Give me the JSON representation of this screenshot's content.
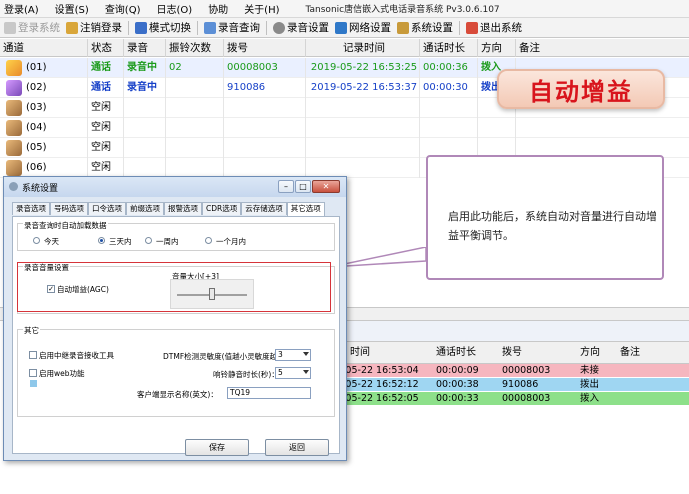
{
  "menu": {
    "items": [
      "登录(A)",
      "设置(S)",
      "查询(Q)",
      "日志(O)",
      "协助",
      "关于(H)"
    ],
    "title": "Tansonic唐信嵌入式电话录音系统 Pv3.0.6.107"
  },
  "toolbar": {
    "items": [
      {
        "label": "登录系统",
        "icon": "key-icon",
        "disabled": true
      },
      {
        "label": "注销登录",
        "icon": "lock-icon",
        "disabled": false
      },
      {
        "label": "模式切换",
        "icon": "monitor-icon",
        "disabled": false
      },
      {
        "label": "录音查询",
        "icon": "search-doc-icon",
        "disabled": false
      },
      {
        "label": "录音设置",
        "icon": "gear-icon",
        "disabled": false
      },
      {
        "label": "网络设置",
        "icon": "network-icon",
        "disabled": false
      },
      {
        "label": "系统设置",
        "icon": "settings-icon",
        "disabled": false
      },
      {
        "label": "退出系统",
        "icon": "exit-icon",
        "disabled": false
      }
    ]
  },
  "top_table": {
    "columns": [
      "通道",
      "状态",
      "录音",
      "振铃次数",
      "拨号",
      "记录时间",
      "通话时长",
      "方向",
      "备注"
    ],
    "rows": [
      {
        "channel": "(01)",
        "status": "通话",
        "record": "录音中",
        "rings": "02",
        "number": "00008003",
        "time": "2019-05-22 16:53:25",
        "duration": "00:00:36",
        "direction": "拨入",
        "color": "green"
      },
      {
        "channel": "(02)",
        "status": "通话",
        "record": "录音中",
        "rings": "",
        "number": "910086",
        "time": "2019-05-22 16:53:37",
        "duration": "00:00:30",
        "direction": "拨出",
        "color": "blue"
      },
      {
        "channel": "(03)",
        "status": "空闲",
        "record": "",
        "rings": "",
        "number": "",
        "time": "",
        "duration": "",
        "direction": "",
        "color": "none"
      },
      {
        "channel": "(04)",
        "status": "空闲",
        "record": "",
        "rings": "",
        "number": "",
        "time": "",
        "duration": "",
        "direction": "",
        "color": "none"
      },
      {
        "channel": "(05)",
        "status": "空闲",
        "record": "",
        "rings": "",
        "number": "",
        "time": "",
        "duration": "",
        "direction": "",
        "color": "none"
      },
      {
        "channel": "(06)",
        "status": "空闲",
        "record": "",
        "rings": "",
        "number": "",
        "time": "",
        "duration": "",
        "direction": "",
        "color": "none"
      }
    ]
  },
  "bottom_table": {
    "columns": [
      "时间",
      "通话时长",
      "拨号",
      "方向",
      "备注"
    ],
    "rows": [
      {
        "time": "-05-22 16:53:04",
        "duration": "00:00:09",
        "number": "00008003",
        "direction": "未接",
        "bg": "#f6b6bf"
      },
      {
        "time": "-05-22 16:52:12",
        "duration": "00:00:38",
        "number": "910086",
        "direction": "拨出",
        "bg": "#9fd6f2"
      },
      {
        "time": "-05-22 16:52:05",
        "duration": "00:00:33",
        "number": "00008003",
        "direction": "拨入",
        "bg": "#8de08a"
      }
    ]
  },
  "badge": {
    "text": "自动增益",
    "color": "#d8141c"
  },
  "callout": {
    "text": "启用此功能后，系统自动对音量进行自动增益平衡调节。"
  },
  "dialog": {
    "title": "系统设置",
    "tabs": [
      "录音选项",
      "号码选项",
      "口令选项",
      "前缀选项",
      "报警选项",
      "CDR选项",
      "云存储选项",
      "其它选项"
    ],
    "active_tab": "其它选项",
    "query_group": {
      "label": "录音查询时自动加载数据",
      "options": [
        "今天",
        "三天内",
        "一周内",
        "一个月内"
      ],
      "selected": "三天内"
    },
    "volume_group": {
      "label": "录音音量设置",
      "agc_label": "自动增益(AGC)",
      "agc_checked": true,
      "volume_label": "音量大小[+3]",
      "volume_level": 0.5
    },
    "other_group": {
      "label": "其它",
      "relay_label": "启用中继录音接收工具",
      "web_label": "启用web功能",
      "dtmf_label": "DTMF检测灵敏度(值越小灵敏度越高)：",
      "dtmf_value": "3",
      "mute_label": "响铃静音时长(秒)：",
      "mute_value": "5",
      "client_label": "客户端显示名称(英文)：",
      "client_value": "TQ19"
    },
    "save_label": "保存",
    "back_label": "返回"
  }
}
